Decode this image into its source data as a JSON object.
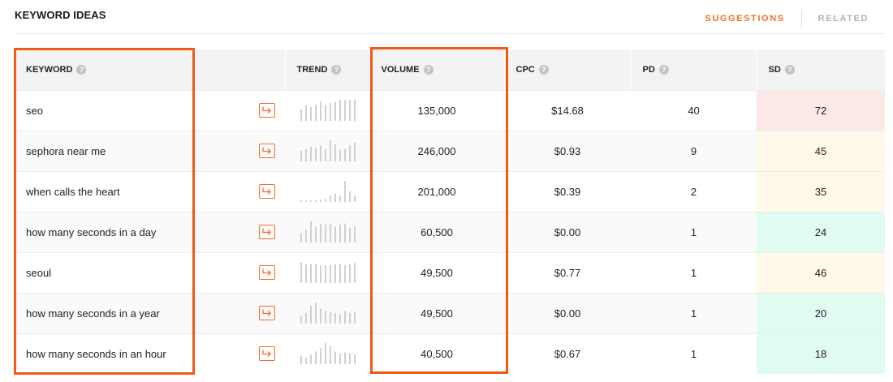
{
  "header": {
    "title": "KEYWORD IDEAS",
    "tabs": [
      {
        "label": "SUGGESTIONS",
        "active": true
      },
      {
        "label": "RELATED",
        "active": false
      }
    ]
  },
  "table": {
    "columns": {
      "keyword": "KEYWORD",
      "trend": "TREND",
      "volume": "VOLUME",
      "cpc": "CPC",
      "pd": "PD",
      "sd": "SD"
    },
    "help_glyph": "?",
    "rows": [
      {
        "keyword": "seo",
        "volume": "135,000",
        "cpc": "$14.68",
        "pd": "40",
        "sd": "72",
        "sd_level": "red",
        "trend": [
          0.55,
          0.75,
          0.65,
          0.75,
          0.9,
          0.75,
          0.85,
          0.9,
          1.0,
          1.0,
          1.0,
          1.0
        ]
      },
      {
        "keyword": "sephora near me",
        "volume": "246,000",
        "cpc": "$0.93",
        "pd": "9",
        "sd": "45",
        "sd_level": "yellow",
        "trend": [
          0.5,
          0.6,
          0.7,
          0.65,
          0.75,
          0.6,
          1.0,
          0.8,
          0.55,
          0.6,
          0.75,
          0.9
        ]
      },
      {
        "keyword": "when calls the heart",
        "volume": "201,000",
        "cpc": "$0.39",
        "pd": "2",
        "sd": "35",
        "sd_level": "yellow",
        "trend": [
          0.08,
          0.08,
          0.08,
          0.1,
          0.1,
          0.15,
          0.3,
          0.4,
          0.3,
          1.0,
          0.5,
          0.3
        ]
      },
      {
        "keyword": "how many seconds in a day",
        "volume": "60,500",
        "cpc": "$0.00",
        "pd": "1",
        "sd": "24",
        "sd_level": "green",
        "trend": [
          0.45,
          0.6,
          1.0,
          0.75,
          0.9,
          0.85,
          0.9,
          0.75,
          0.85,
          0.9,
          0.7,
          0.75
        ]
      },
      {
        "keyword": "seoul",
        "volume": "49,500",
        "cpc": "$0.77",
        "pd": "1",
        "sd": "46",
        "sd_level": "yellow",
        "trend": [
          1.0,
          0.9,
          0.9,
          0.9,
          0.85,
          0.85,
          0.85,
          0.9,
          0.9,
          0.85,
          0.9,
          0.95
        ]
      },
      {
        "keyword": "how many seconds in a year",
        "volume": "49,500",
        "cpc": "$0.00",
        "pd": "1",
        "sd": "20",
        "sd_level": "green",
        "trend": [
          0.35,
          0.5,
          0.85,
          1.0,
          0.7,
          0.6,
          0.55,
          0.5,
          0.45,
          0.6,
          0.5,
          0.55
        ]
      },
      {
        "keyword": "how many seconds in an hour",
        "volume": "40,500",
        "cpc": "$0.67",
        "pd": "1",
        "sd": "18",
        "sd_level": "green",
        "trend": [
          0.4,
          0.3,
          0.45,
          0.6,
          0.75,
          1.0,
          0.85,
          0.6,
          0.5,
          0.55,
          0.5,
          0.45
        ]
      }
    ]
  },
  "colors": {
    "accent": "#f0702a",
    "highlight_box": "#f05a14",
    "sd_red": "#fde8e8",
    "sd_yellow": "#fef9e8",
    "sd_green": "#e0fbf0",
    "trend_bar": "#d0d0d0"
  },
  "icons": {
    "help": "question-circle-icon",
    "open": "arrow-return-icon"
  }
}
